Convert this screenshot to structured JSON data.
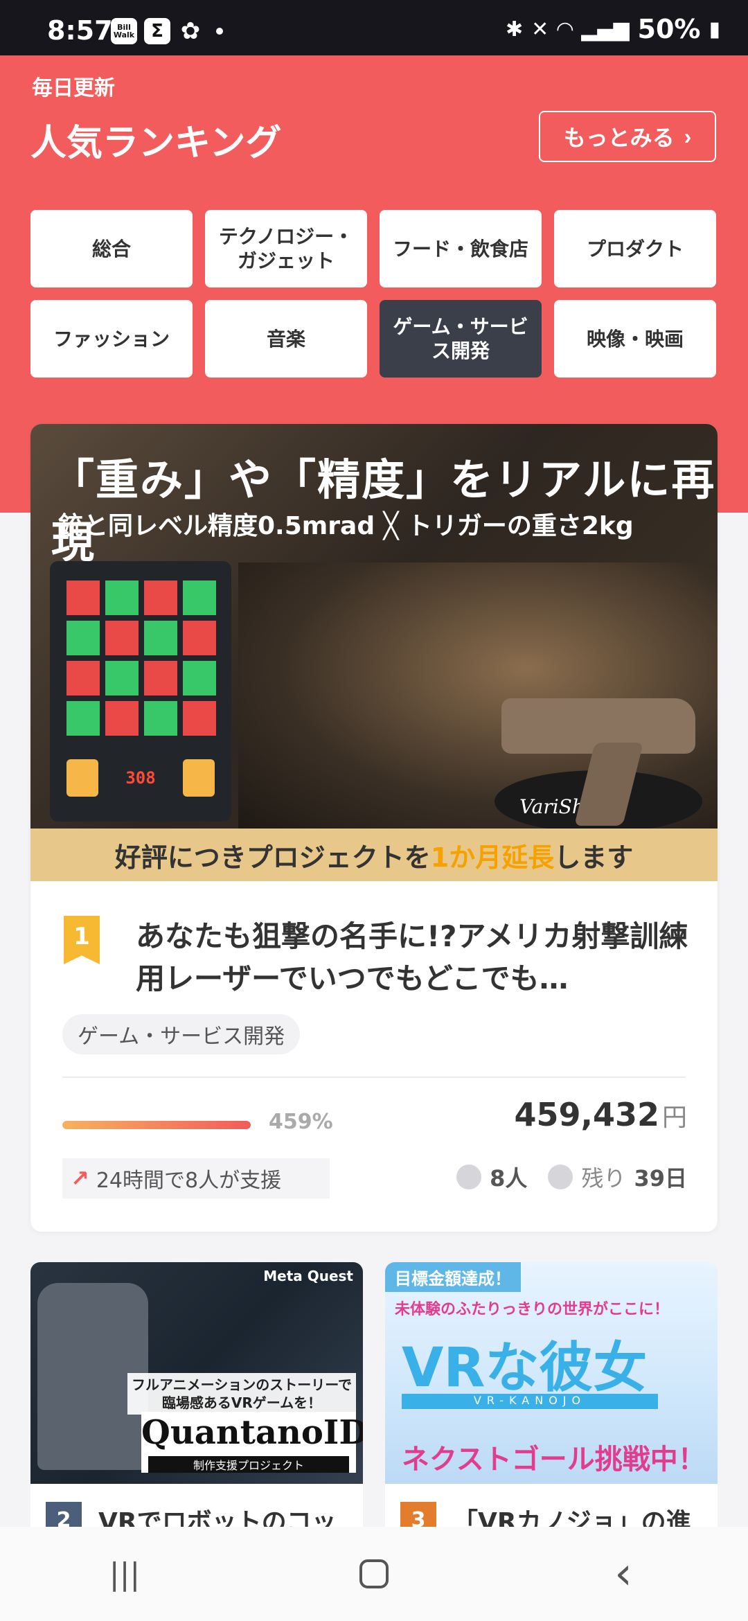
{
  "status_bar": {
    "time": "8:57",
    "apps": [
      "Bill Walk",
      "Σ",
      "✿"
    ],
    "battery": "50%"
  },
  "hero": {
    "daily_label": "毎日更新",
    "title": "人気ランキング",
    "more_button": "もっとみる"
  },
  "categories": [
    {
      "label": "総合"
    },
    {
      "label": "テクノロジー・ガジェット"
    },
    {
      "label": "フード・飲食店"
    },
    {
      "label": "プロダクト"
    },
    {
      "label": "ファッション"
    },
    {
      "label": "音楽"
    },
    {
      "label": "ゲーム・サービス開発",
      "active": true
    },
    {
      "label": "映像・映画"
    }
  ],
  "featured": {
    "banner_headline": "「重み」や「精度」をリアルに再現",
    "banner_specs": "銃と同レベル精度0.5mrad ╳ トリガーの重さ2kg",
    "banner_footer_pre": "好評につきプロジェクトを",
    "banner_footer_hl": "1か月延長",
    "banner_footer_post": "します",
    "banner_score": "308",
    "brand": "VariShot",
    "rank": "1",
    "title": "あなたも狙撃の名手に!?アメリカ射撃訓練用レーザーでいつでもどこでも…",
    "tag": "ゲーム・サービス開発",
    "progress_percent": 459,
    "percent_text": "459%",
    "amount": "459,432",
    "currency": "円",
    "support_text": "24時間で8人が支援",
    "supporters": "8人",
    "remaining_label": "残り",
    "remaining_days": "39日"
  },
  "cards": [
    {
      "rank": "2",
      "title": "VRでロボットのコッ",
      "image_badge": "Meta Quest",
      "image_copy": "フルアニメーションのストーリーで臨場感あるVRゲームを！",
      "image_title": "QuantanoID",
      "image_sub": "制作支援プロジェクト"
    },
    {
      "rank": "3",
      "title": "「VRカノジョ」の進",
      "image_badge": "目標金額達成！",
      "image_copy": "未体験のふたりっきりの世界がここに！",
      "image_title": "VRな彼女",
      "image_band": "VR-KANOJO",
      "image_next": "ネクストゴール挑戦中！"
    }
  ],
  "nav": {
    "recents": "|||",
    "back": "‹"
  },
  "colors": {
    "accent": "#f25c5c",
    "active_category": "#3b3f4a",
    "rank_gold": "#f7b832"
  }
}
